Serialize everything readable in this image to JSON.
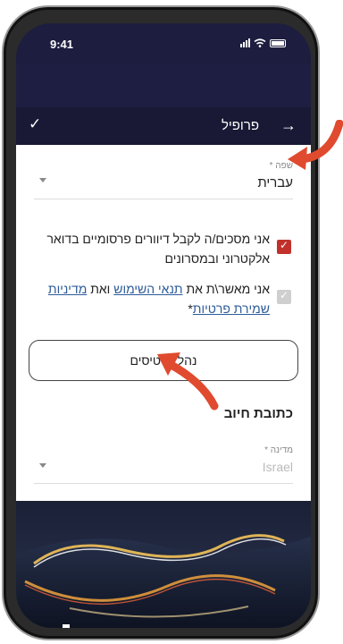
{
  "status_bar": {
    "time": "9:41"
  },
  "header": {
    "title": "פרופיל"
  },
  "language": {
    "label": "שפה *",
    "value": "עברית"
  },
  "consents": {
    "marketing": "אני מסכים/ה לקבל דיוורים פרסומיים בדואר אלקטרוני ובמסרונים",
    "terms_prefix": "אני מאשר\\ת את ",
    "terms_link": "תנאי השימוש",
    "terms_and": " ואת ",
    "privacy_link_1": "מדיניות",
    "privacy_link_2": "שמירת פרטיות",
    "terms_suffix": "*"
  },
  "manage_cards_button": "נהל כרטיסים",
  "billing": {
    "title": "כתובת חיוב",
    "country_label": "מדינה *",
    "country_value": "Israel"
  },
  "colors": {
    "header_bg": "#191936",
    "accent_red": "#c0312b",
    "arrow": "#e04a2f"
  },
  "icons": [
    "back-arrow-icon",
    "checkmark-icon",
    "chevron-down-icon",
    "signal-icon",
    "wifi-icon",
    "battery-icon"
  ]
}
